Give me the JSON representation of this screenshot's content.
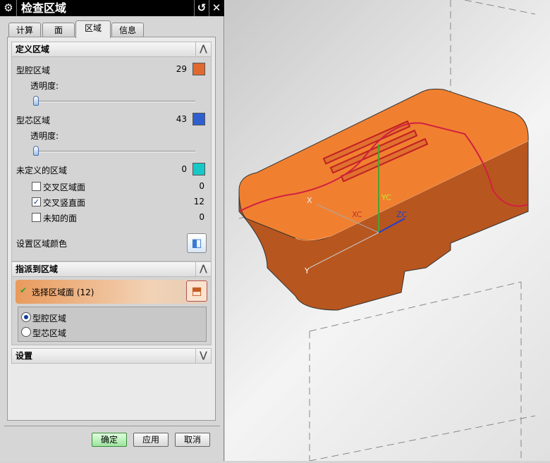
{
  "title": "检查区域",
  "tabs": [
    "计算",
    "面",
    "区域",
    "信息"
  ],
  "define": {
    "header": "定义区域",
    "cavity": {
      "label": "型腔区域",
      "count": "29",
      "color": "#e0692f"
    },
    "transparency_label": "透明度:",
    "core": {
      "label": "型芯区域",
      "count": "43",
      "color": "#2f5fcf"
    },
    "undefined": {
      "label": "未定义的区域",
      "count": "0",
      "color": "#16c8c8"
    },
    "subitems": [
      {
        "label": "交叉区域面",
        "count": "0",
        "checked": false
      },
      {
        "label": "交叉竖直面",
        "count": "12",
        "checked": true
      },
      {
        "label": "未知的面",
        "count": "0",
        "checked": false
      }
    ],
    "set_color_label": "设置区域颜色",
    "cavity_transparency": 0,
    "core_transparency": 0
  },
  "assign": {
    "header": "指派到区域",
    "select_label": "选择区域面 (12)",
    "options": [
      "型腔区域",
      "型芯区域"
    ],
    "selected": "型腔区域"
  },
  "settings": {
    "header": "设置"
  },
  "buttons": {
    "ok": "确定",
    "apply": "应用",
    "cancel": "取消"
  },
  "viewport": {
    "labels": {
      "x": "X",
      "xc": "XC",
      "yc": "YC",
      "zc": "ZC",
      "y": "Y"
    }
  }
}
